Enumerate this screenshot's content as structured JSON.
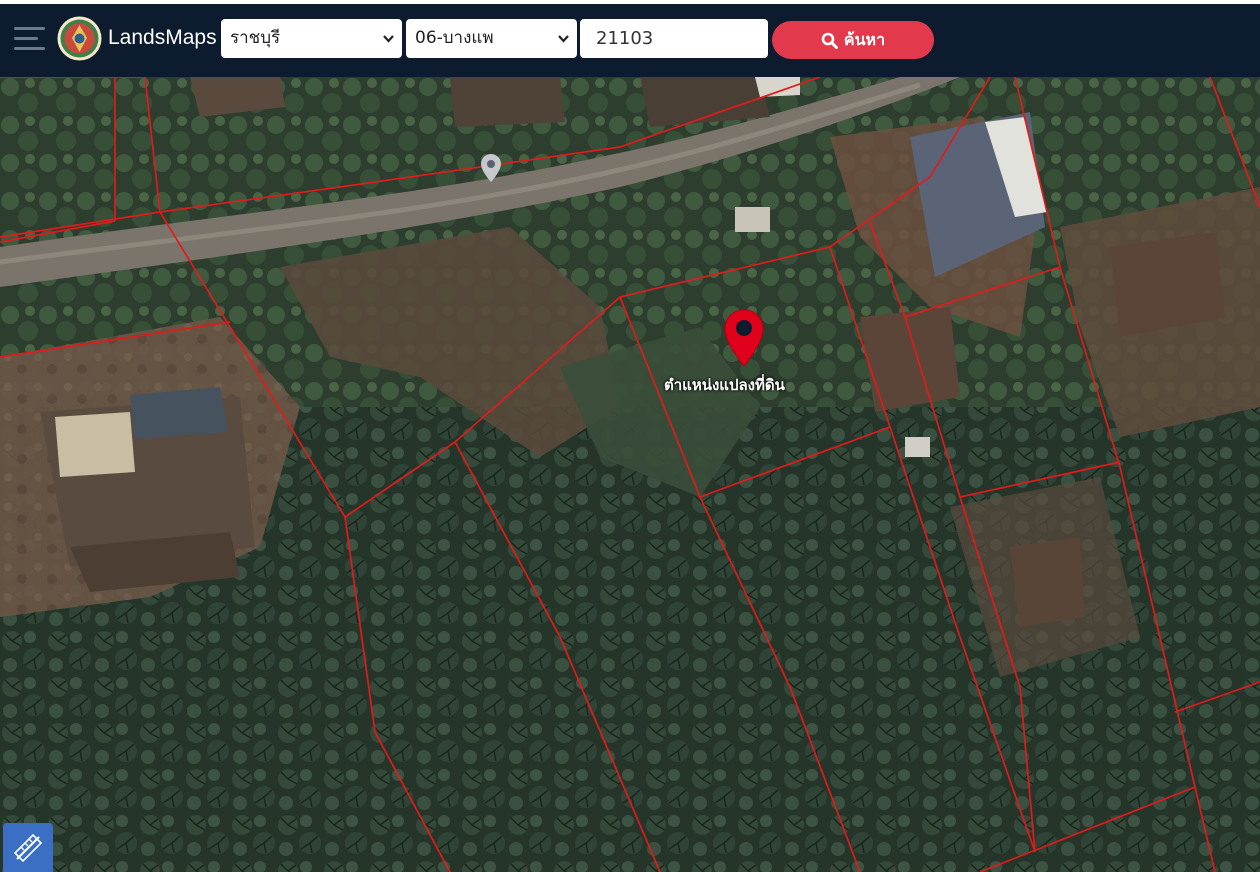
{
  "header": {
    "brand": "LandsMaps",
    "province": "ราชบุรี",
    "district": "06-บางแพ",
    "parcel_number": "21103",
    "search_label": "ค้นหา"
  },
  "map": {
    "marker_label": "ตำแหน่งแปลงที่ดิน",
    "boundary_color": "#e01b1b",
    "marker_color": "#e0001b"
  },
  "icons": {
    "menu": "hamburger-menu-icon",
    "logo": "department-of-lands-seal",
    "search": "magnifier-icon",
    "tool": "ruler-measure-icon"
  }
}
